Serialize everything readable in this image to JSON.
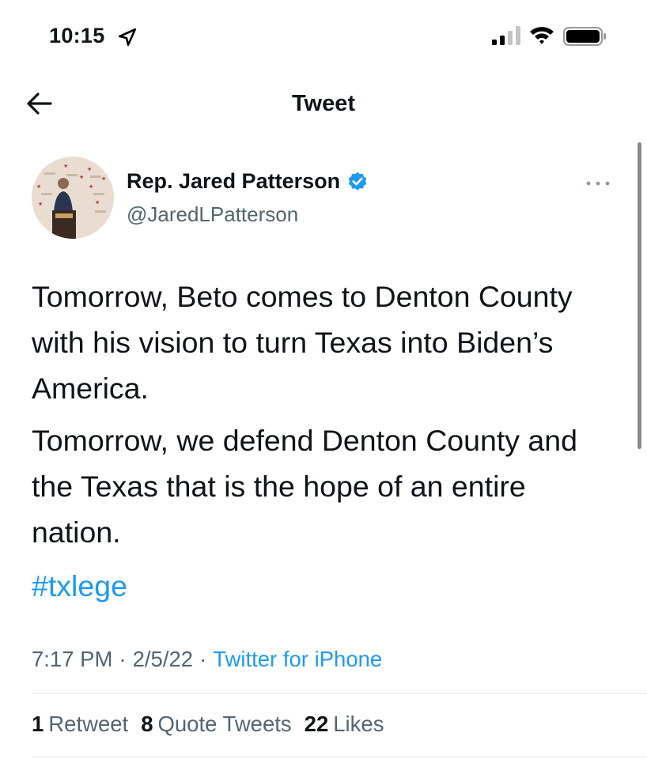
{
  "status_bar": {
    "time": "10:15"
  },
  "header": {
    "title": "Tweet"
  },
  "author": {
    "name": "Rep. Jared Patterson",
    "handle": "@JaredLPatterson",
    "verified": true
  },
  "tweet": {
    "paragraph1": "Tomorrow, Beto comes to Denton County with his vision to turn Texas into Biden’s America.",
    "paragraph2": "Tomorrow, we defend Denton County and the Texas that is the hope of an entire nation.",
    "hashtag": "#txlege"
  },
  "meta": {
    "time": "7:17 PM",
    "separator": "·",
    "date": "2/5/22",
    "source": "Twitter for iPhone"
  },
  "stats": {
    "retweets_count": "1",
    "retweets_label": "Retweet",
    "quotes_count": "8",
    "quotes_label": "Quote Tweets",
    "likes_count": "22",
    "likes_label": "Likes"
  },
  "colors": {
    "text": "#0f1419",
    "secondary": "#536471",
    "link": "#1d9bf0",
    "verified": "#1d9bf0"
  },
  "icons": {
    "location": "location-arrow-icon",
    "signal": "cellular-signal-icon",
    "wifi": "wifi-icon",
    "battery": "battery-icon",
    "back": "back-arrow-icon",
    "verified": "verified-badge-icon",
    "more": "more-options-icon"
  }
}
